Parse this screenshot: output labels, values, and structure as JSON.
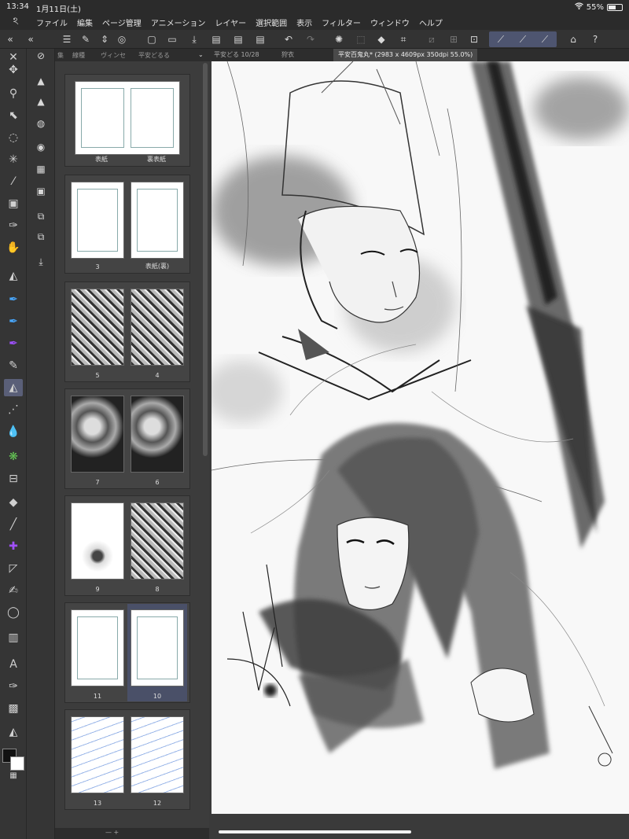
{
  "status": {
    "time": "13:34",
    "date": "1月11日(土)",
    "wifi": "wifi-icon",
    "battery_pct": "55%",
    "battery_level": 0.55
  },
  "menu": [
    "ファイル",
    "編集",
    "ページ管理",
    "アニメーション",
    "レイヤー",
    "選択範囲",
    "表示",
    "フィルター",
    "ウィンドウ",
    "ヘルプ"
  ],
  "panel": {
    "tabs": [
      "集",
      "線種",
      "ヴィンセ",
      "平安どるる"
    ],
    "spreads": [
      {
        "left": "表紙",
        "right": "裏表紙"
      },
      {
        "left": "3",
        "right": "表紙(裏)"
      },
      {
        "left": "5",
        "right": "4"
      },
      {
        "left": "7",
        "right": "6"
      },
      {
        "left": "9",
        "right": "8"
      },
      {
        "left": "11",
        "right": "10"
      },
      {
        "left": "13",
        "right": "12"
      }
    ],
    "footer": "—  +"
  },
  "doc_tabs": [
    {
      "label": "平安どる 10/28"
    },
    {
      "label": "狩衣"
    },
    {
      "label": "平安百鬼丸* (2983 x 4609px 350dpi 55.0%)"
    }
  ],
  "accent": "#5a5f78"
}
